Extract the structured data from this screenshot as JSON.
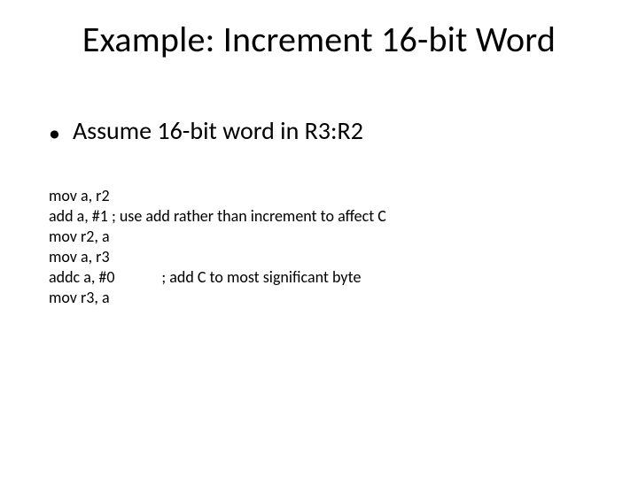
{
  "title": "Example: Increment 16-bit Word",
  "bullet": {
    "marker": "•",
    "text": "Assume 16-bit word in R3:R2"
  },
  "code": {
    "lines": [
      "mov a, r2",
      "add a, #1 ; use add rather than increment to affect C",
      "mov r2, a",
      "mov a, r3",
      "addc a, #0             ; add C to most significant byte",
      "mov r3, a"
    ]
  }
}
